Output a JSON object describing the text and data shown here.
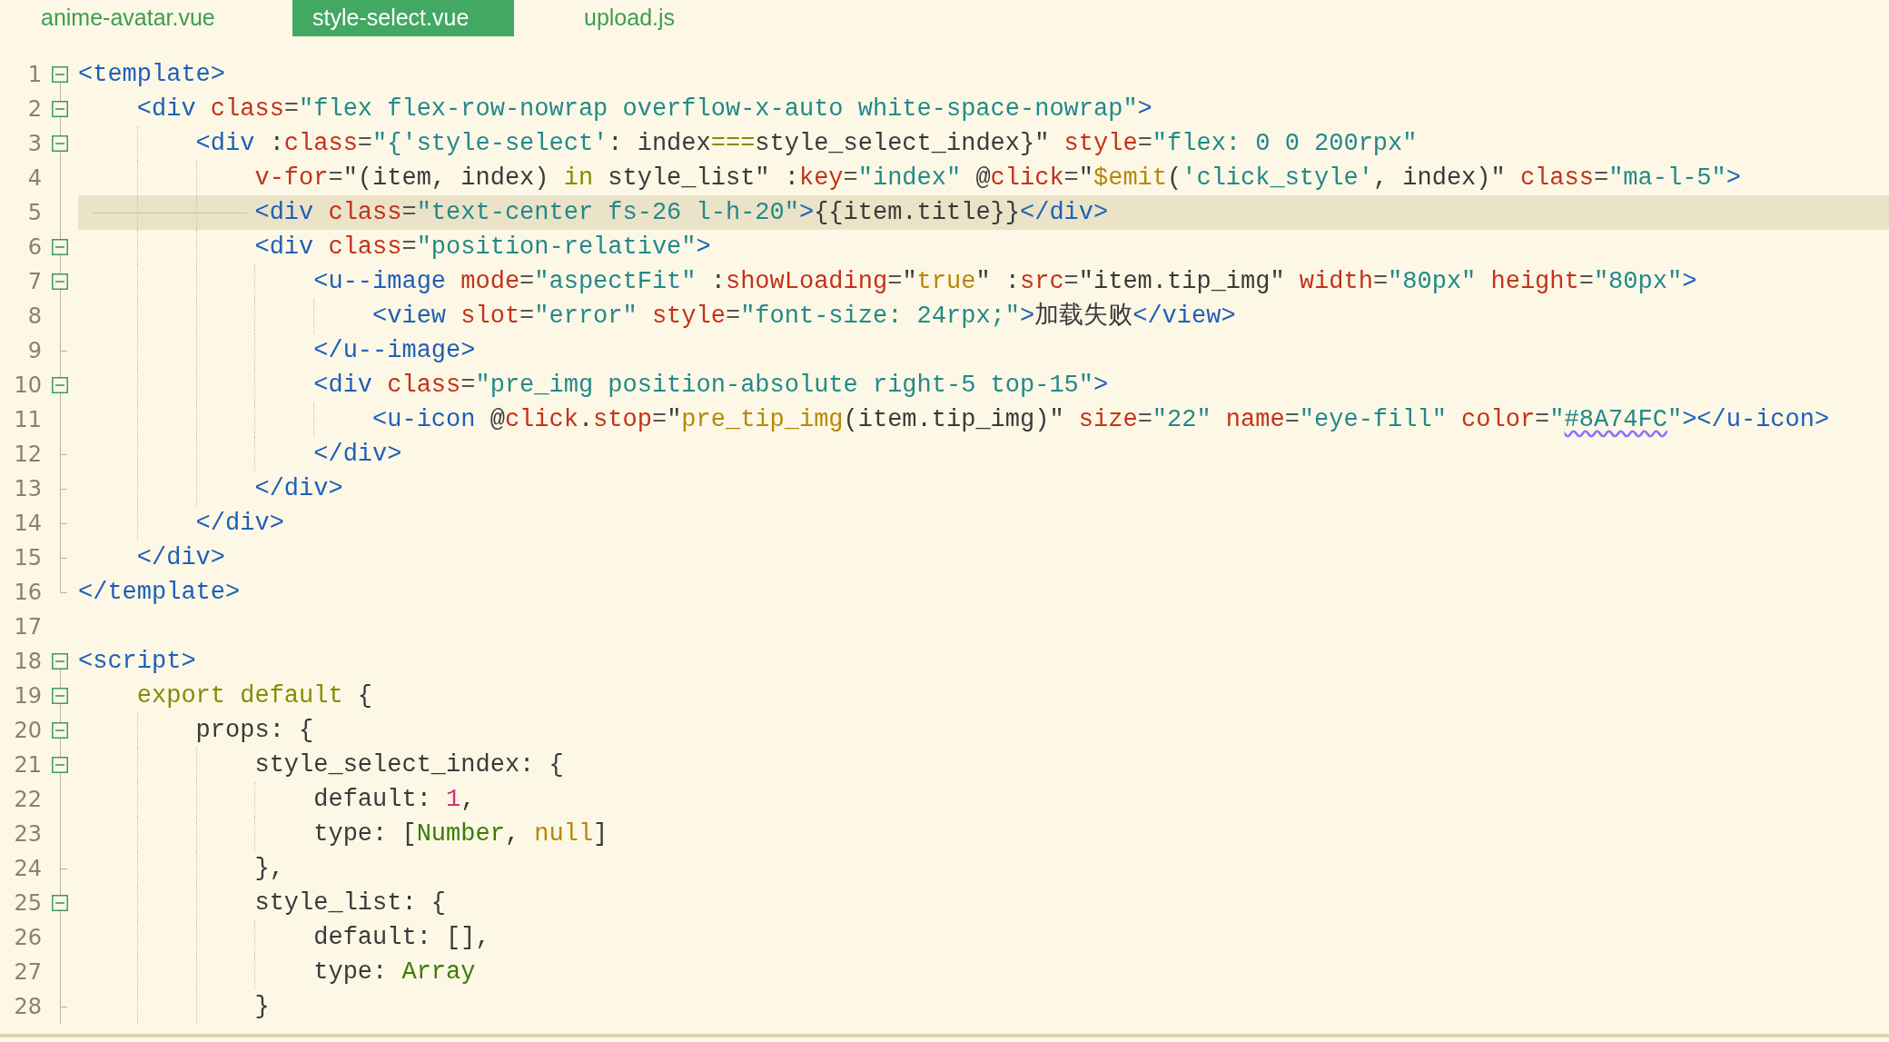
{
  "tabs": [
    {
      "label": "anime-avatar.vue",
      "selected": false
    },
    {
      "label": "style-select.vue",
      "selected": true
    },
    {
      "label": "upload.js",
      "selected": false
    }
  ],
  "lines": [
    {
      "number": "1",
      "kind": "open",
      "current": false,
      "tokens": [
        {
          "kind": "tag",
          "text": "<template>"
        }
      ]
    },
    {
      "number": "2",
      "kind": "open",
      "current": false,
      "tokens": [
        {
          "kind": "tag",
          "text": "    <div"
        },
        {
          "kind": "attr",
          "text": " class"
        },
        {
          "kind": "op",
          "text": "="
        },
        {
          "kind": "str",
          "text": "\"flex flex-row-nowrap overflow-x-auto white-space-nowrap\""
        },
        {
          "kind": "tag",
          "text": ">"
        }
      ]
    },
    {
      "number": "3",
      "kind": "open",
      "current": false,
      "tokens": [
        {
          "kind": "tag",
          "text": "        <div"
        },
        {
          "kind": "txt",
          "text": " :"
        },
        {
          "kind": "attr",
          "text": "class"
        },
        {
          "kind": "op",
          "text": "="
        },
        {
          "kind": "str",
          "text": "\"{'style-select'"
        },
        {
          "kind": "txt",
          "text": ": index"
        },
        {
          "kind": "kw",
          "text": "==="
        },
        {
          "kind": "txt",
          "text": "style_select_index}\" "
        },
        {
          "kind": "attr",
          "text": "style"
        },
        {
          "kind": "op",
          "text": "="
        },
        {
          "kind": "str",
          "text": "\"flex: 0 0 200rpx\""
        }
      ]
    },
    {
      "number": "4",
      "kind": "mid",
      "current": false,
      "tokens": [
        {
          "kind": "attr",
          "text": "            v-for"
        },
        {
          "kind": "op",
          "text": "="
        },
        {
          "kind": "txt",
          "text": "\"(item, index) "
        },
        {
          "kind": "kw",
          "text": "in"
        },
        {
          "kind": "txt",
          "text": " style_list\" :"
        },
        {
          "kind": "attr",
          "text": "key"
        },
        {
          "kind": "op",
          "text": "="
        },
        {
          "kind": "str",
          "text": "\"index\""
        },
        {
          "kind": "txt",
          "text": " @"
        },
        {
          "kind": "attr",
          "text": "click"
        },
        {
          "kind": "op",
          "text": "="
        },
        {
          "kind": "txt",
          "text": "\""
        },
        {
          "kind": "fn",
          "text": "$emit"
        },
        {
          "kind": "txt",
          "text": "("
        },
        {
          "kind": "str",
          "text": "'click_style'"
        },
        {
          "kind": "txt",
          "text": ", index)\" "
        },
        {
          "kind": "attr",
          "text": "class"
        },
        {
          "kind": "op",
          "text": "="
        },
        {
          "kind": "str",
          "text": "\"ma-l-5\""
        },
        {
          "kind": "tag",
          "text": ">"
        }
      ]
    },
    {
      "number": "5",
      "kind": "mid",
      "current": true,
      "tokens": [
        {
          "kind": "tag",
          "text": "            <div"
        },
        {
          "kind": "attr",
          "text": " class"
        },
        {
          "kind": "op",
          "text": "="
        },
        {
          "kind": "str",
          "text": "\"text-center fs-26 l-h-20\""
        },
        {
          "kind": "tag",
          "text": ">"
        },
        {
          "kind": "txt",
          "text": "{{item.title}}"
        },
        {
          "kind": "tag",
          "text": "</div>"
        }
      ]
    },
    {
      "number": "6",
      "kind": "open",
      "current": false,
      "tokens": [
        {
          "kind": "tag",
          "text": "            <div"
        },
        {
          "kind": "attr",
          "text": " class"
        },
        {
          "kind": "op",
          "text": "="
        },
        {
          "kind": "str",
          "text": "\"position-relative\""
        },
        {
          "kind": "tag",
          "text": ">"
        }
      ]
    },
    {
      "number": "7",
      "kind": "open",
      "current": false,
      "tokens": [
        {
          "kind": "tag",
          "text": "                <u--image"
        },
        {
          "kind": "attr",
          "text": " mode"
        },
        {
          "kind": "op",
          "text": "="
        },
        {
          "kind": "str",
          "text": "\"aspectFit\""
        },
        {
          "kind": "txt",
          "text": " :"
        },
        {
          "kind": "attr",
          "text": "showLoading"
        },
        {
          "kind": "op",
          "text": "="
        },
        {
          "kind": "txt",
          "text": "\""
        },
        {
          "kind": "fn",
          "text": "true"
        },
        {
          "kind": "txt",
          "text": "\" :"
        },
        {
          "kind": "attr",
          "text": "src"
        },
        {
          "kind": "op",
          "text": "="
        },
        {
          "kind": "txt",
          "text": "\"item.tip_img\" "
        },
        {
          "kind": "attr",
          "text": "width"
        },
        {
          "kind": "op",
          "text": "="
        },
        {
          "kind": "str",
          "text": "\"80px\""
        },
        {
          "kind": "attr",
          "text": " height"
        },
        {
          "kind": "op",
          "text": "="
        },
        {
          "kind": "str",
          "text": "\"80px\""
        },
        {
          "kind": "tag",
          "text": ">"
        }
      ]
    },
    {
      "number": "8",
      "kind": "mid",
      "current": false,
      "tokens": [
        {
          "kind": "tag",
          "text": "                    <view"
        },
        {
          "kind": "attr",
          "text": " slot"
        },
        {
          "kind": "op",
          "text": "="
        },
        {
          "kind": "str",
          "text": "\"error\""
        },
        {
          "kind": "attr",
          "text": " style"
        },
        {
          "kind": "op",
          "text": "="
        },
        {
          "kind": "str",
          "text": "\"font-size: 24rpx;\""
        },
        {
          "kind": "tag",
          "text": ">"
        },
        {
          "kind": "txt",
          "text": "加载失败"
        },
        {
          "kind": "tag",
          "text": "</view>"
        }
      ]
    },
    {
      "number": "9",
      "kind": "end",
      "current": false,
      "tokens": [
        {
          "kind": "tag",
          "text": "                </u--image>"
        }
      ]
    },
    {
      "number": "10",
      "kind": "open",
      "current": false,
      "tokens": [
        {
          "kind": "tag",
          "text": "                <div"
        },
        {
          "kind": "attr",
          "text": " class"
        },
        {
          "kind": "op",
          "text": "="
        },
        {
          "kind": "str",
          "text": "\"pre_img position-absolute right-5 top-15\""
        },
        {
          "kind": "tag",
          "text": ">"
        }
      ]
    },
    {
      "number": "11",
      "kind": "mid",
      "current": false,
      "tokens": [
        {
          "kind": "tag",
          "text": "                    <u-icon"
        },
        {
          "kind": "txt",
          "text": " @"
        },
        {
          "kind": "attr",
          "text": "click"
        },
        {
          "kind": "txt",
          "text": "."
        },
        {
          "kind": "attr",
          "text": "stop"
        },
        {
          "kind": "op",
          "text": "="
        },
        {
          "kind": "txt",
          "text": "\""
        },
        {
          "kind": "fn",
          "text": "pre_tip_img"
        },
        {
          "kind": "txt",
          "text": "(item.tip_img)\" "
        },
        {
          "kind": "attr",
          "text": "size"
        },
        {
          "kind": "op",
          "text": "="
        },
        {
          "kind": "str",
          "text": "\"22\""
        },
        {
          "kind": "attr",
          "text": " name"
        },
        {
          "kind": "op",
          "text": "="
        },
        {
          "kind": "str",
          "text": "\"eye-fill\""
        },
        {
          "kind": "attr",
          "text": " color"
        },
        {
          "kind": "op",
          "text": "="
        },
        {
          "kind": "str",
          "text": "\""
        },
        {
          "kind": "colorref",
          "text": "#8A74FC"
        },
        {
          "kind": "str",
          "text": "\""
        },
        {
          "kind": "tag",
          "text": "></u-icon>"
        }
      ]
    },
    {
      "number": "12",
      "kind": "end",
      "current": false,
      "tokens": [
        {
          "kind": "tag",
          "text": "                </div>"
        }
      ]
    },
    {
      "number": "13",
      "kind": "end",
      "current": false,
      "tokens": [
        {
          "kind": "tag",
          "text": "            </div>"
        }
      ]
    },
    {
      "number": "14",
      "kind": "end",
      "current": false,
      "tokens": [
        {
          "kind": "tag",
          "text": "        </div>"
        }
      ]
    },
    {
      "number": "15",
      "kind": "end",
      "current": false,
      "tokens": [
        {
          "kind": "tag",
          "text": "    </div>"
        }
      ]
    },
    {
      "number": "16",
      "kind": "last",
      "current": false,
      "tokens": [
        {
          "kind": "tag",
          "text": "</template>"
        }
      ]
    },
    {
      "number": "17",
      "kind": "plain",
      "current": false
    },
    {
      "number": "18",
      "kind": "open",
      "current": false,
      "tokens": [
        {
          "kind": "tag",
          "text": "<script>"
        }
      ]
    },
    {
      "number": "19",
      "kind": "open",
      "current": false,
      "tokens": [
        {
          "kind": "kw",
          "text": "    export default"
        },
        {
          "kind": "txt",
          "text": " {"
        }
      ]
    },
    {
      "number": "20",
      "kind": "open",
      "current": false,
      "tokens": [
        {
          "kind": "txt",
          "text": "        props: {"
        }
      ]
    },
    {
      "number": "21",
      "kind": "open",
      "current": false,
      "tokens": [
        {
          "kind": "txt",
          "text": "            style_select_index: {"
        }
      ]
    },
    {
      "number": "22",
      "kind": "mid",
      "current": false,
      "tokens": [
        {
          "kind": "txt",
          "text": "                default: "
        },
        {
          "kind": "num",
          "text": "1"
        },
        {
          "kind": "txt",
          "text": ","
        }
      ]
    },
    {
      "number": "23",
      "kind": "mid",
      "current": false,
      "tokens": [
        {
          "kind": "txt",
          "text": "                type: ["
        },
        {
          "kind": "type",
          "text": "Number"
        },
        {
          "kind": "txt",
          "text": ", "
        },
        {
          "kind": "fn",
          "text": "null"
        },
        {
          "kind": "txt",
          "text": "]"
        }
      ]
    },
    {
      "number": "24",
      "kind": "end",
      "current": false,
      "tokens": [
        {
          "kind": "txt",
          "text": "            },"
        }
      ]
    },
    {
      "number": "25",
      "kind": "open",
      "current": false,
      "tokens": [
        {
          "kind": "txt",
          "text": "            style_list: {"
        }
      ]
    },
    {
      "number": "26",
      "kind": "mid",
      "current": false,
      "tokens": [
        {
          "kind": "txt",
          "text": "                default: [],"
        }
      ]
    },
    {
      "number": "27",
      "kind": "mid",
      "current": false,
      "tokens": [
        {
          "kind": "txt",
          "text": "                type: "
        },
        {
          "kind": "type",
          "text": "Array"
        }
      ]
    },
    {
      "number": "28",
      "kind": "end",
      "current": false,
      "tokens": [
        {
          "kind": "txt",
          "text": "            }"
        }
      ]
    }
  ]
}
